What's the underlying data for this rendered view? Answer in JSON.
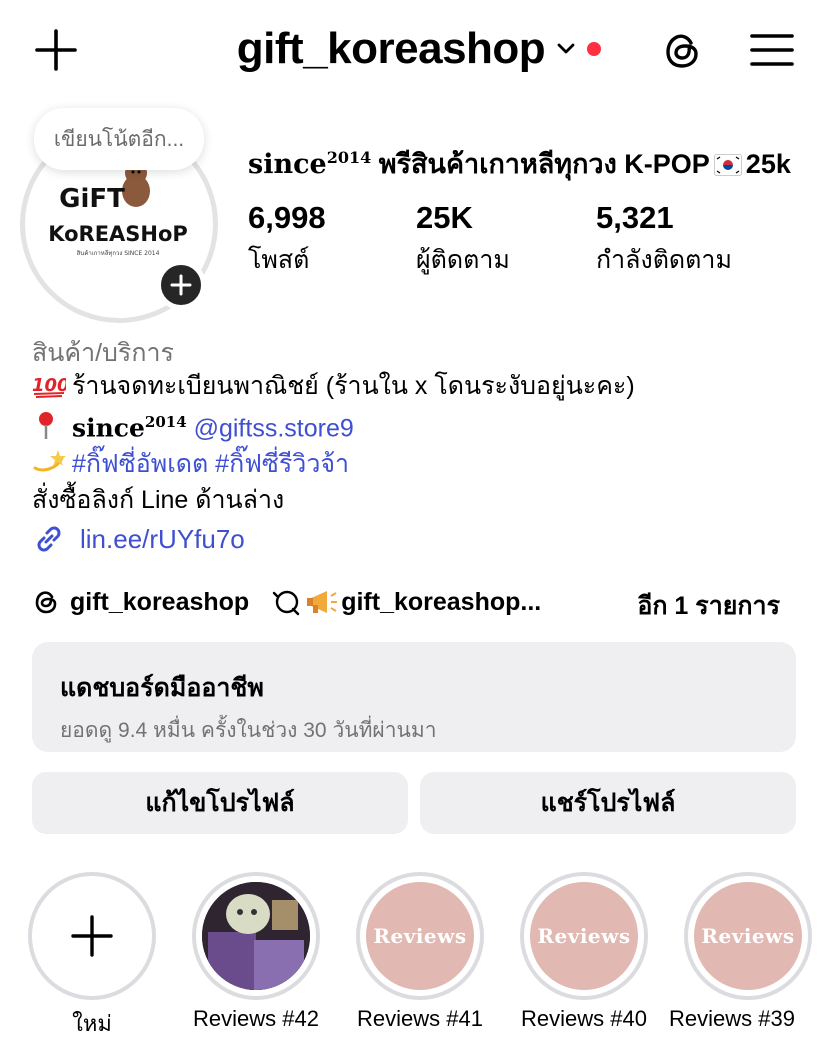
{
  "header": {
    "username": "gift_koreashop",
    "icons": [
      "plus-icon",
      "chevron-down-icon",
      "threads-icon",
      "menu-icon"
    ],
    "notification_dot_color": "#ff3040"
  },
  "avatar": {
    "note_placeholder": "เขียนโน้ตอีก...",
    "logo_line1": "GiFT",
    "logo_line2": "KoREASHoP",
    "logo_small": "สินค้าเกาหลีทุกวง SINCE 2014"
  },
  "profile": {
    "name_prefix": "since",
    "name_sup": "2014",
    "name_text": " พรีสินค้าเกาหลีทุกวง K-POP",
    "name_suffix": "25k",
    "stats": [
      {
        "value": "6,998",
        "label": "โพสต์"
      },
      {
        "value": "25K",
        "label": "ผู้ติดตาม"
      },
      {
        "value": "5,321",
        "label": "กำลังติดตาม"
      }
    ]
  },
  "bio": {
    "category": "สินค้า/บริการ",
    "line1": "ร้านจดทะเบียนพาณิชย์ (ร้านใน x โดนระงับอยู่นะคะ)",
    "line2_prefix": "since",
    "line2_sup": "2014",
    "line2_mention": "@giftss.store9",
    "line3_tags": "#กิ๊ฟซี่อัพเดต #กิ๊ฟซี่รีวิวจ้า",
    "line4": "สั่งซื้อลิงก์ Line ด้านล่าง",
    "link": "lin.ee/rUYfu7o"
  },
  "threads_row": {
    "threads_name": "gift_koreashop",
    "channel_name": "gift_koreashop...",
    "more": "อีก 1 รายการ"
  },
  "dashboard": {
    "title": "แดชบอร์ดมืออาชีพ",
    "subtitle": "ยอดดู 9.4 หมื่น ครั้งในช่วง 30 วันที่ผ่านมา"
  },
  "buttons": {
    "edit": "แก้ไขโปรไฟล์",
    "share": "แชร์โปรไฟล์"
  },
  "highlights": [
    {
      "label": "ใหม่"
    },
    {
      "label": "Reviews #42"
    },
    {
      "label": "Reviews #41",
      "cover_text": "Reviews"
    },
    {
      "label": "Reviews #40",
      "cover_text": "Reviews"
    },
    {
      "label": "Reviews #39",
      "cover_text": "Reviews"
    }
  ],
  "colors": {
    "link": "#3f4fd1",
    "button_bg": "#efeff1",
    "highlight_pink": "#e1b8b2"
  }
}
